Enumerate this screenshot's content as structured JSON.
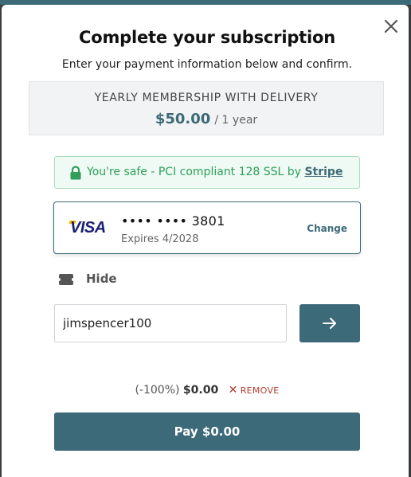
{
  "modal": {
    "title": "Complete your subscription",
    "subtitle": "Enter your payment information below and confirm.",
    "close_icon": "close-icon"
  },
  "plan": {
    "name": "YEARLY MEMBERSHIP WITH DELIVERY",
    "price": "$50.00",
    "period": "/ 1 year"
  },
  "security": {
    "icon": "lock-icon",
    "text": "You're safe - PCI compliant 128 SSL by",
    "provider": "Stripe"
  },
  "card": {
    "brand": "VISA",
    "number": "•••• •••• 3801",
    "expiry": "Expires 4/2028",
    "change_label": "Change"
  },
  "coupon": {
    "toggle_icon": "ticket-icon",
    "toggle_label": "Hide",
    "value": "jimspencer100",
    "apply_icon": "arrow-right-icon"
  },
  "discount": {
    "percent": "(-100%)",
    "amount": "$0.00",
    "remove_label": "REMOVE"
  },
  "pay_button_label": "Pay $0.00",
  "colors": {
    "accent": "#3d6a78",
    "success": "#2f9e5b",
    "danger": "#b33a2b"
  }
}
